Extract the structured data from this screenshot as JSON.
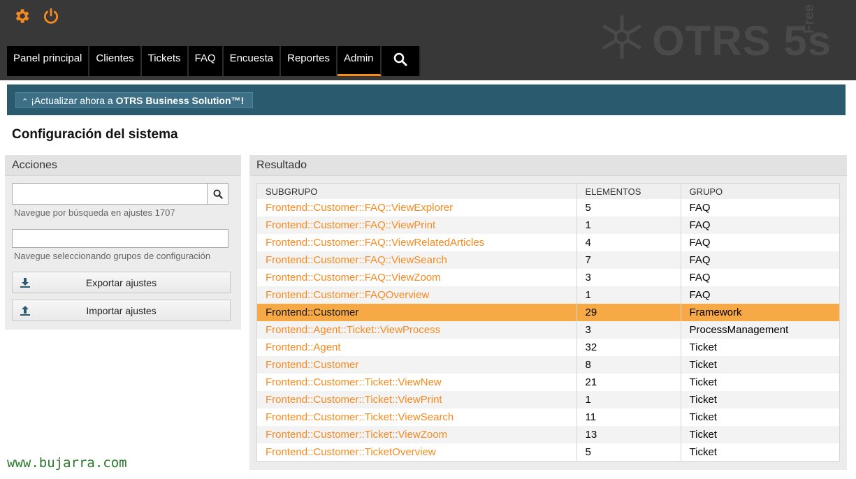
{
  "nav": {
    "items": [
      "Panel principal",
      "Clientes",
      "Tickets",
      "FAQ",
      "Encuesta",
      "Reportes",
      "Admin"
    ],
    "active_index": 6
  },
  "logo": {
    "text": "OTRS 5s",
    "edition": "Free"
  },
  "banner": {
    "prefix": "¡Actualizar ahora a ",
    "product": "OTRS Business Solution™!"
  },
  "page_title": "Configuración del sistema",
  "actions": {
    "title": "Acciones",
    "search_value": "",
    "search_hint": "Navegue por búsqueda en ajustes 1707",
    "group_value": "",
    "group_hint": "Navegue seleccionando grupos de configuración",
    "export_label": "Exportar ajustes",
    "import_label": "Importar ajustes"
  },
  "results": {
    "title": "Resultado",
    "columns": [
      "SUBGRUPO",
      "ELEMENTOS",
      "GRUPO"
    ],
    "rows": [
      {
        "subgroup": "Frontend::Customer::FAQ::ViewExplorer",
        "elements": "5",
        "group": "FAQ",
        "highlight": false
      },
      {
        "subgroup": "Frontend::Customer::FAQ::ViewPrint",
        "elements": "1",
        "group": "FAQ",
        "highlight": false
      },
      {
        "subgroup": "Frontend::Customer::FAQ::ViewRelatedArticles",
        "elements": "4",
        "group": "FAQ",
        "highlight": false
      },
      {
        "subgroup": "Frontend::Customer::FAQ::ViewSearch",
        "elements": "7",
        "group": "FAQ",
        "highlight": false
      },
      {
        "subgroup": "Frontend::Customer::FAQ::ViewZoom",
        "elements": "3",
        "group": "FAQ",
        "highlight": false
      },
      {
        "subgroup": "Frontend::Customer::FAQOverview",
        "elements": "1",
        "group": "FAQ",
        "highlight": false
      },
      {
        "subgroup": "Frontend::Customer",
        "elements": "29",
        "group": "Framework",
        "highlight": true
      },
      {
        "subgroup": "Frontend::Agent::Ticket::ViewProcess",
        "elements": "3",
        "group": "ProcessManagement",
        "highlight": false
      },
      {
        "subgroup": "Frontend::Agent",
        "elements": "32",
        "group": "Ticket",
        "highlight": false
      },
      {
        "subgroup": "Frontend::Customer",
        "elements": "8",
        "group": "Ticket",
        "highlight": false
      },
      {
        "subgroup": "Frontend::Customer::Ticket::ViewNew",
        "elements": "21",
        "group": "Ticket",
        "highlight": false
      },
      {
        "subgroup": "Frontend::Customer::Ticket::ViewPrint",
        "elements": "1",
        "group": "Ticket",
        "highlight": false
      },
      {
        "subgroup": "Frontend::Customer::Ticket::ViewSearch",
        "elements": "11",
        "group": "Ticket",
        "highlight": false
      },
      {
        "subgroup": "Frontend::Customer::Ticket::ViewZoom",
        "elements": "13",
        "group": "Ticket",
        "highlight": false
      },
      {
        "subgroup": "Frontend::Customer::TicketOverview",
        "elements": "5",
        "group": "Ticket",
        "highlight": false
      }
    ]
  },
  "watermark": "www.bujarra.com",
  "colors": {
    "accent": "#f68a1e",
    "header_bg": "#383838",
    "banner_bg": "#2a5a6e",
    "highlight_row": "#f6a945"
  }
}
